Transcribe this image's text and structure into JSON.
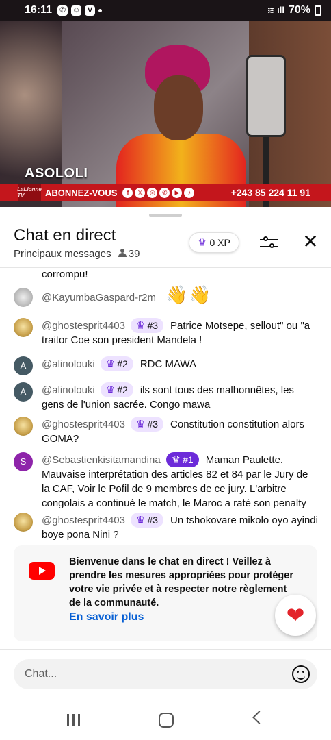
{
  "status_bar": {
    "time": "16:11",
    "battery": "70%",
    "notification_icons": [
      "whatsapp-icon",
      "snapchat-icon",
      "vimeo-icon"
    ]
  },
  "video": {
    "overlay_brand": "ASOLOLI",
    "channel_logo": "LaLionne TV",
    "subscribe_text": "ABONNEZ-VOUS",
    "phone_number": "+243 85 224 11 91",
    "social_icons": [
      "facebook-icon",
      "x-icon",
      "instagram-icon",
      "whatsapp-icon",
      "youtube-icon",
      "tiktok-icon"
    ],
    "accent_color": "#c4161c"
  },
  "chat": {
    "title": "Chat en direct",
    "subtitle": "Principaux messages",
    "viewer_count": "39",
    "xp": "0 XP",
    "partial_message": "corrompu!",
    "messages": [
      {
        "author": "@KayumbaGaspard-r2m",
        "badge": "",
        "text": "👋👋"
      },
      {
        "author": "@ghostesprit4403",
        "badge": "#3",
        "text": "Patrice Motsepe, sellout\" ou \"a traitor Coe son president Mandela !"
      },
      {
        "author": "@alinolouki",
        "avatar": "A",
        "badge": "#2",
        "text": "RDC MAWA"
      },
      {
        "author": "@alinolouki",
        "avatar": "A",
        "badge": "#2",
        "text": "ils sont tous des malhonnêtes, les gens de l'union sacrée. Congo mawa"
      },
      {
        "author": "@ghostesprit4403",
        "badge": "#3",
        "text": "Constitution constitution alors GOMA?"
      },
      {
        "author": "@Sebastienkisitamandina",
        "avatar": "S",
        "badge": "#1",
        "text": "Maman Paulette. Mauvaise interprétation des articles 82 et 84 par le Jury de la CAF, Voir le Pofil de 9 membres de ce jury. L'arbitre congolais a continué le match, le Maroc a raté son penalty"
      },
      {
        "author": "@ghostesprit4403",
        "badge": "#3",
        "text": "Un tshokovare mikolo oyo ayindi boye pona Nini ?"
      }
    ],
    "welcome": {
      "text": "Bienvenue dans le chat en direct ! Veillez à prendre les mesures appropriées pour protéger votre vie privée et à respecter notre règlement de la communauté.",
      "link": "En savoir plus"
    },
    "input_placeholder": "Chat..."
  },
  "colors": {
    "badge_bg": "#ede2ff",
    "badge_rank1": "#6c2bd9",
    "link": "#065fd4",
    "heart": "#e3242b"
  }
}
